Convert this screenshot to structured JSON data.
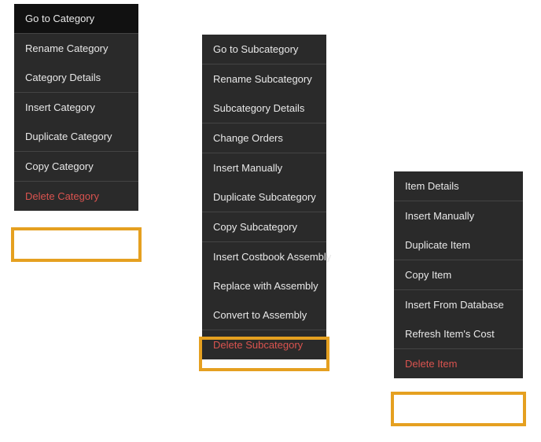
{
  "menus": {
    "category": {
      "items": [
        {
          "label": "Go to Category",
          "hovered": true
        },
        {
          "label": "Rename Category"
        },
        {
          "label": "Category Details"
        },
        {
          "label": "Insert Category"
        },
        {
          "label": "Duplicate Category"
        },
        {
          "label": "Copy Category"
        },
        {
          "label": "Delete Category",
          "danger": true,
          "highlighted": true
        }
      ],
      "groups": [
        [
          0
        ],
        [
          1,
          2
        ],
        [
          3,
          4
        ],
        [
          5
        ],
        [
          6
        ]
      ]
    },
    "subcategory": {
      "items": [
        {
          "label": "Go to Subcategory"
        },
        {
          "label": "Rename Subcategory"
        },
        {
          "label": "Subcategory Details"
        },
        {
          "label": "Change Orders"
        },
        {
          "label": "Insert Manually"
        },
        {
          "label": "Duplicate Subcategory"
        },
        {
          "label": "Copy Subcategory"
        },
        {
          "label": "Insert Costbook Assembly"
        },
        {
          "label": "Replace with Assembly"
        },
        {
          "label": "Convert to Assembly"
        },
        {
          "label": "Delete Subcategory",
          "danger": true,
          "highlighted": true
        }
      ],
      "groups": [
        [
          0
        ],
        [
          1,
          2
        ],
        [
          3
        ],
        [
          4,
          5
        ],
        [
          6
        ],
        [
          7,
          8,
          9
        ],
        [
          10
        ]
      ]
    },
    "item": {
      "items": [
        {
          "label": "Item Details"
        },
        {
          "label": "Insert Manually"
        },
        {
          "label": "Duplicate Item"
        },
        {
          "label": "Copy Item"
        },
        {
          "label": "Insert From Database"
        },
        {
          "label": "Refresh Item's Cost"
        },
        {
          "label": "Delete Item",
          "danger": true,
          "highlighted": true
        }
      ],
      "groups": [
        [
          0
        ],
        [
          1,
          2
        ],
        [
          3
        ],
        [
          4,
          5
        ],
        [
          6
        ]
      ]
    }
  }
}
